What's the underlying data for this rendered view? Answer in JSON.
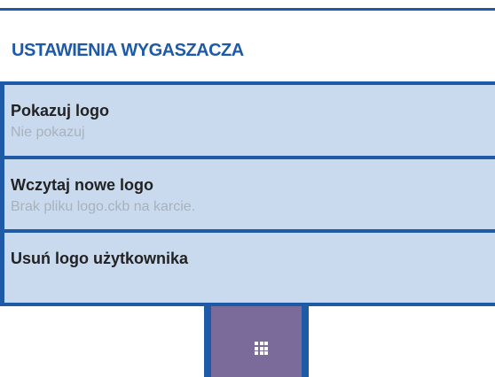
{
  "section": {
    "title": "USTAWIENIA WYGASZACZA"
  },
  "menu": {
    "items": [
      {
        "label": "Pokazuj logo",
        "value": "Nie pokazuj"
      },
      {
        "label": "Wczytaj nowe logo",
        "value": "Brak pliku logo.ckb na karcie."
      },
      {
        "label": "Usuń logo użytkownika",
        "value": ""
      }
    ]
  },
  "bottom_nav": {
    "apps_icon": "grid-icon"
  },
  "colors": {
    "accent": "#1f5aa6",
    "item_background": "#c9daef",
    "apps_button": "#7a6b9b"
  }
}
